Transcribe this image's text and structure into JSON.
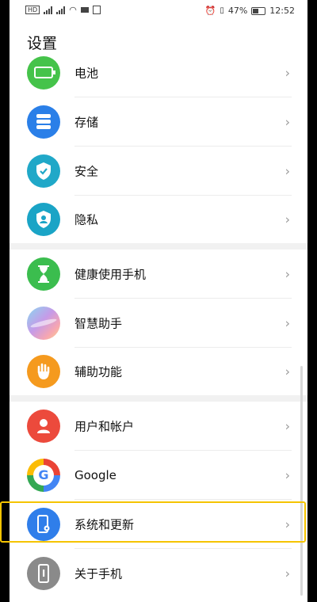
{
  "status_bar": {
    "left_icons": [
      "sim1-icon",
      "sim2-icon",
      "signal-icon",
      "signal-icon",
      "wifi-icon",
      "video-icon",
      "gallery-icon"
    ],
    "battery_percent": "47%",
    "time": "12:52"
  },
  "page": {
    "title": "设置"
  },
  "settings_items": [
    {
      "label": "电池",
      "icon": "battery-icon",
      "color": "#45c34a"
    },
    {
      "label": "存储",
      "icon": "storage-icon",
      "color": "#2a7fe8"
    },
    {
      "label": "安全",
      "icon": "shield-icon",
      "color": "#20a8c8"
    },
    {
      "label": "隐私",
      "icon": "privacy-icon",
      "color": "#1aa4c6"
    },
    {
      "label": "健康使用手机",
      "icon": "hourglass-icon",
      "color": "#3bbd4e"
    },
    {
      "label": "智慧助手",
      "icon": "assistant-icon",
      "color": "#c59be8"
    },
    {
      "label": "辅助功能",
      "icon": "hand-icon",
      "color": "#f59a1e"
    },
    {
      "label": "用户和帐户",
      "icon": "user-icon",
      "color": "#ec4a3c"
    },
    {
      "label": "Google",
      "icon": "google-icon",
      "color": "#ffffff"
    },
    {
      "label": "系统和更新",
      "icon": "system-update-icon",
      "color": "#2f7eea"
    },
    {
      "label": "关于手机",
      "icon": "phone-info-icon",
      "color": "#8a8a8a"
    }
  ],
  "chevron": "›"
}
